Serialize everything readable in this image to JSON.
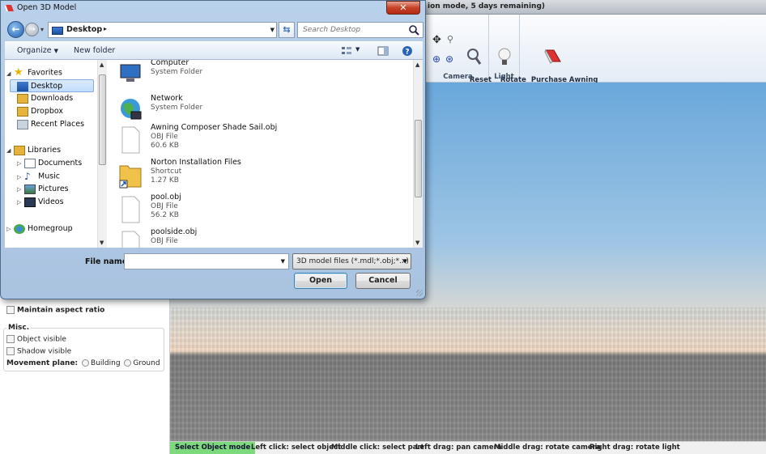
{
  "app": {
    "title_fragment": "ion mode, 5 days remaining)"
  },
  "ribbon": {
    "reset_camera": "Reset\nCamera",
    "rotate_light": "Rotate\nLight",
    "purchase": "Purchase Awning\nComposer",
    "groups": {
      "camera": "Camera",
      "light": "Light"
    }
  },
  "left_panel": {
    "maintain_aspect": "Maintain aspect ratio",
    "misc_label": "Misc.",
    "object_visible": "Object visible",
    "shadow_visible": "Shadow visible",
    "movement_plane_label": "Movement plane:",
    "building": "Building",
    "ground": "Ground"
  },
  "statusbar": {
    "mode": "Select Object mode",
    "hints": [
      "Left click: select object",
      "Middle click: select part",
      "Left drag: pan camera",
      "Middle drag: rotate camera",
      "Right drag: rotate light"
    ]
  },
  "dialog": {
    "title": "Open 3D Model",
    "address": "Desktop",
    "search_placeholder": "Search Desktop",
    "organize": "Organize",
    "new_folder": "New folder",
    "nav": {
      "favorites": "Favorites",
      "desktop": "Desktop",
      "downloads": "Downloads",
      "dropbox": "Dropbox",
      "recent": "Recent Places",
      "libraries": "Libraries",
      "documents": "Documents",
      "music": "Music",
      "pictures": "Pictures",
      "videos": "Videos",
      "homegroup": "Homegroup"
    },
    "files": [
      {
        "name": "Computer",
        "line2": "System Folder",
        "line3": ""
      },
      {
        "name": "Network",
        "line2": "System Folder",
        "line3": ""
      },
      {
        "name": "Awning Composer Shade Sail.obj",
        "line2": "OBJ File",
        "line3": "60.6 KB"
      },
      {
        "name": "Norton Installation Files",
        "line2": "Shortcut",
        "line3": "1.27 KB"
      },
      {
        "name": "pool.obj",
        "line2": "OBJ File",
        "line3": "56.2 KB"
      },
      {
        "name": "poolside.obj",
        "line2": "OBJ File",
        "line3": ""
      }
    ],
    "file_name_label": "File name:",
    "file_name_value": "",
    "file_type": "3D model files (*.mdl;*.obj;*.x)",
    "open": "Open",
    "cancel": "Cancel"
  },
  "colors": {
    "status_mode": "#7cd97c",
    "selection": "#c1dcfc",
    "close": "#c7432a"
  }
}
